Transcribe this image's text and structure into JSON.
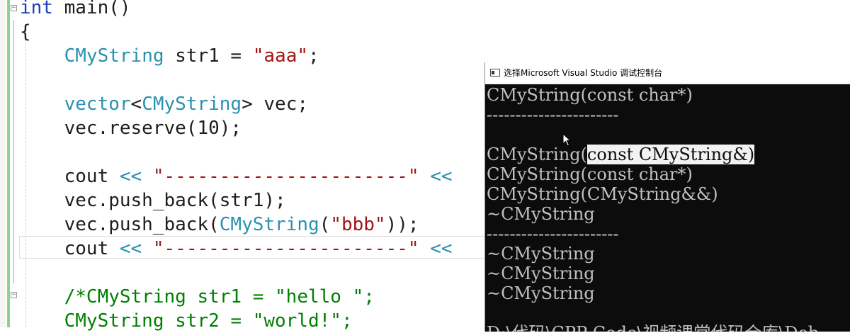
{
  "editor": {
    "lines": [
      {
        "segs": [
          {
            "t": "int",
            "c": "kw"
          },
          {
            "t": " main()",
            "c": "op"
          }
        ]
      },
      {
        "segs": [
          {
            "t": "{",
            "c": "op"
          }
        ]
      },
      {
        "segs": [
          {
            "t": "    ",
            "c": "op"
          },
          {
            "t": "CMyString",
            "c": "ty"
          },
          {
            "t": " str1 = ",
            "c": "op"
          },
          {
            "t": "\"aaa\"",
            "c": "str"
          },
          {
            "t": ";",
            "c": "op"
          }
        ]
      },
      {
        "segs": []
      },
      {
        "segs": [
          {
            "t": "    ",
            "c": "op"
          },
          {
            "t": "vector",
            "c": "ty"
          },
          {
            "t": "<",
            "c": "op"
          },
          {
            "t": "CMyString",
            "c": "ty"
          },
          {
            "t": "> vec;",
            "c": "op"
          }
        ]
      },
      {
        "segs": [
          {
            "t": "    vec.reserve(10);",
            "c": "op"
          }
        ]
      },
      {
        "segs": []
      },
      {
        "segs": [
          {
            "t": "    cout ",
            "c": "op"
          },
          {
            "t": "<<",
            "c": "ty"
          },
          {
            "t": " ",
            "c": "op"
          },
          {
            "t": "\"----------------------\"",
            "c": "str"
          },
          {
            "t": " ",
            "c": "op"
          },
          {
            "t": "<<",
            "c": "ty"
          }
        ]
      },
      {
        "segs": [
          {
            "t": "    vec.push_back(str1);",
            "c": "op"
          }
        ]
      },
      {
        "segs": [
          {
            "t": "    vec.push_back(",
            "c": "op"
          },
          {
            "t": "CMyString",
            "c": "ty"
          },
          {
            "t": "(",
            "c": "op"
          },
          {
            "t": "\"bbb\"",
            "c": "str"
          },
          {
            "t": "));",
            "c": "op"
          }
        ]
      },
      {
        "segs": [
          {
            "t": "    cout ",
            "c": "op"
          },
          {
            "t": "<<",
            "c": "ty"
          },
          {
            "t": " ",
            "c": "op"
          },
          {
            "t": "\"----------------------\"",
            "c": "str"
          },
          {
            "t": " ",
            "c": "op"
          },
          {
            "t": "<<",
            "c": "ty"
          }
        ]
      },
      {
        "segs": []
      },
      {
        "segs": [
          {
            "t": "    /*CMyString str1 = \"hello \";",
            "c": "cm"
          }
        ]
      },
      {
        "segs": [
          {
            "t": "    CMyString str2 = \"world!\";",
            "c": "cm"
          }
        ]
      }
    ]
  },
  "console": {
    "title": "选择Microsoft Visual Studio 调试控制台",
    "lines": [
      "CMyString(const char*)",
      "-----------------------",
      "",
      "CMyString(const CMyString&)",
      "CMyString(const char*)",
      "CMyString(CMyString&&)",
      "~CMyString",
      "-----------------------",
      "~CMyString",
      "~CMyString",
      "~CMyString",
      "",
      "D:\\代码\\CPP Code\\视频课堂代码仓库\\Deb"
    ],
    "highlight": {
      "line": 3,
      "before": "CMyString(",
      "selected": "const CMyString&)"
    }
  },
  "colors": {
    "keyword": "#1f3fb8",
    "type": "#2b91af",
    "string": "#a31515",
    "comment": "#008000",
    "console_bg": "#0c0c0c",
    "console_text": "#c0c0c0"
  }
}
